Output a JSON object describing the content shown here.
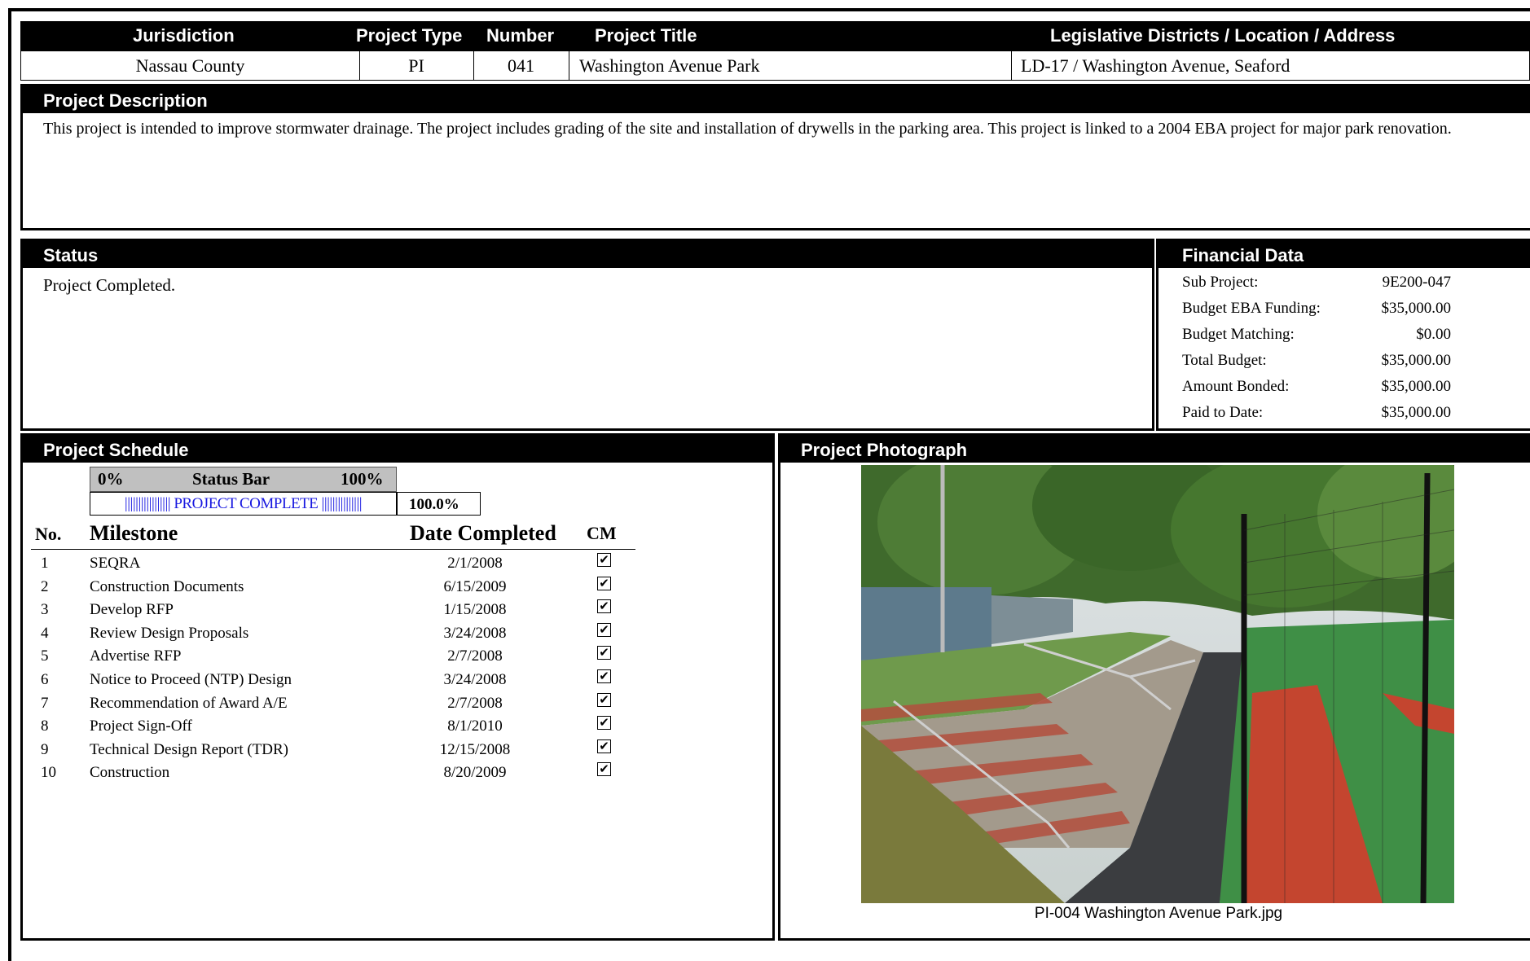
{
  "header": {
    "columns": [
      "Jurisdiction",
      "Project Type",
      "Number",
      "Project Title",
      "Legislative Districts / Location / Address"
    ],
    "values": [
      "Nassau County",
      "PI",
      "041",
      "Washington Avenue Park",
      "LD-17 / Washington Avenue, Seaford"
    ]
  },
  "description": {
    "title": "Project Description",
    "text": "This project is intended to improve stormwater drainage. The project includes grading of the site and installation of drywells in the parking area.  This project is linked to a 2004 EBA project for major park renovation."
  },
  "status": {
    "title": "Status",
    "text": "Project Completed."
  },
  "financial": {
    "title": "Financial Data",
    "rows": [
      {
        "label": "Sub Project:",
        "value": "9E200-047"
      },
      {
        "label": "Budget EBA Funding:",
        "value": "$35,000.00"
      },
      {
        "label": "Budget Matching:",
        "value": "$0.00"
      },
      {
        "label": "Total Budget:",
        "value": "$35,000.00"
      },
      {
        "label": "Amount Bonded:",
        "value": "$35,000.00"
      },
      {
        "label": "Paid to Date:",
        "value": "$35,000.00"
      }
    ]
  },
  "schedule": {
    "title": "Project Schedule",
    "status_bar": {
      "min_label": "0%",
      "title": "Status Bar",
      "max_label": "100%",
      "bar_text": "||||||||||||||||| PROJECT COMPLETE |||||||||||||||",
      "percent": "100.0%",
      "progress": 1.0
    },
    "columns": {
      "no": "No.",
      "milestone": "Milestone",
      "date": "Date Completed",
      "cm": "CM"
    },
    "milestones": [
      {
        "no": "1",
        "name": "SEQRA",
        "date": "2/1/2008"
      },
      {
        "no": "2",
        "name": "Construction Documents",
        "date": "6/15/2009"
      },
      {
        "no": "3",
        "name": "Develop RFP",
        "date": "1/15/2008"
      },
      {
        "no": "4",
        "name": "Review Design Proposals",
        "date": "3/24/2008"
      },
      {
        "no": "5",
        "name": "Advertise RFP",
        "date": "2/7/2008"
      },
      {
        "no": "6",
        "name": "Notice to Proceed (NTP) Design",
        "date": "3/24/2008"
      },
      {
        "no": "7",
        "name": "Recommendation of Award A/E",
        "date": "2/7/2008"
      },
      {
        "no": "8",
        "name": "Project Sign-Off",
        "date": "8/1/2010"
      },
      {
        "no": "9",
        "name": "Technical Design Report (TDR)",
        "date": "12/15/2008"
      },
      {
        "no": "10",
        "name": "Construction",
        "date": "8/20/2009"
      }
    ]
  },
  "photo": {
    "title": "Project Photograph",
    "caption": "PI-004 Washington Avenue Park.jpg"
  }
}
